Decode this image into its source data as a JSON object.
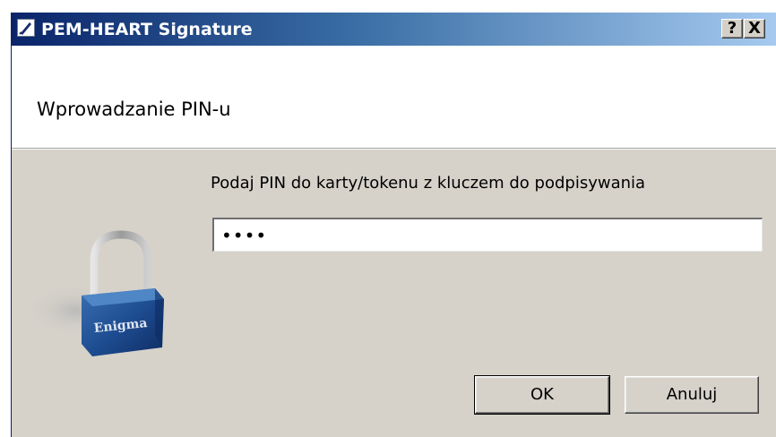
{
  "window": {
    "title": "PEM-HEART Signature",
    "help_button": "?",
    "close_button": "X"
  },
  "header": {
    "title": "Wprowadzanie PIN-u"
  },
  "form": {
    "prompt": "Podaj PIN do karty/tokenu z kluczem do podpisywania",
    "pin_value": "••••"
  },
  "lock": {
    "label": "Enigma",
    "icon": "padlock-icon"
  },
  "buttons": {
    "ok": "OK",
    "cancel": "Anuluj"
  }
}
